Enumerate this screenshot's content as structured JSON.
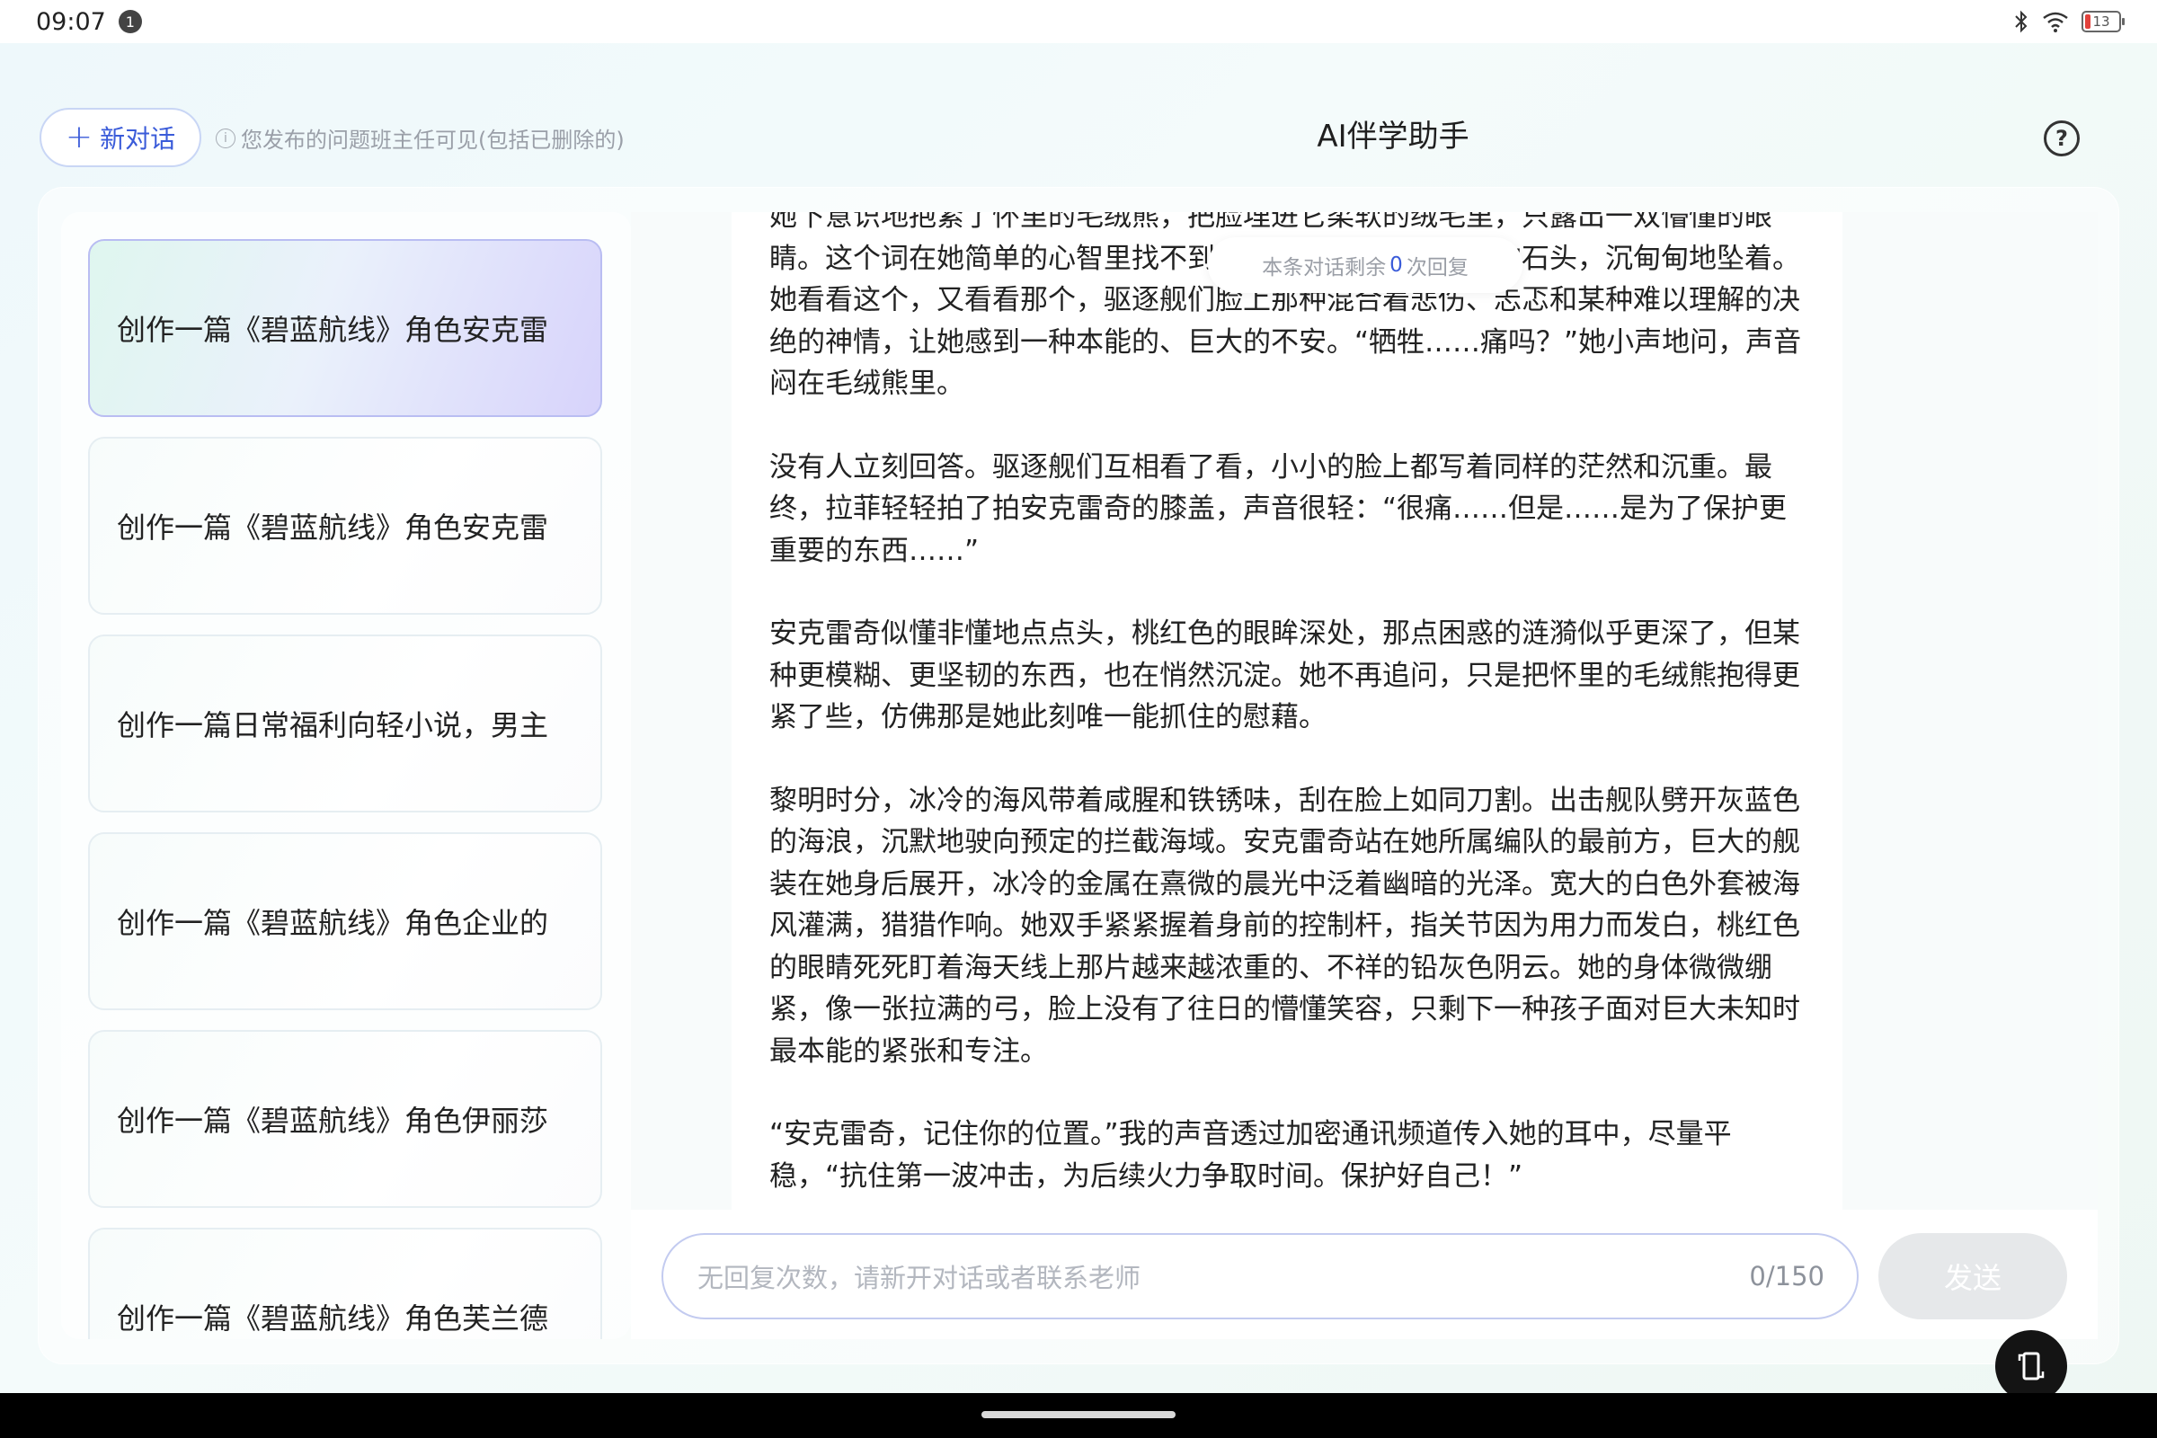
{
  "status_bar": {
    "time": "09:07",
    "notification_count": "1",
    "battery_level": "13"
  },
  "header": {
    "new_chat_label": "新对话",
    "notice": "您发布的问题班主任可见(包括已删除的)",
    "title": "AI伴学助手"
  },
  "sidebar": {
    "items": [
      {
        "label": "创作一篇《碧蓝航线》角色安克雷",
        "active": true
      },
      {
        "label": "创作一篇《碧蓝航线》角色安克雷",
        "active": false
      },
      {
        "label": "创作一篇日常福利向轻小说，男主",
        "active": false
      },
      {
        "label": "创作一篇《碧蓝航线》角色企业的",
        "active": false
      },
      {
        "label": "创作一篇《碧蓝航线》角色伊丽莎",
        "active": false
      },
      {
        "label": "创作一篇《碧蓝航线》角色芙兰德",
        "active": false
      }
    ]
  },
  "conversation": {
    "remaining_prefix": "本条对话剩余",
    "remaining_count": "0",
    "remaining_suffix": "次回复",
    "paragraphs": [
      "她下意识地抱紧了怀里的毛绒熊，把脸埋进它柔软的绒毛里，只露出一双懵懂的眼睛。这个词在她简单的心智里找不到对应的……像一块沉重的石头，沉甸甸地坠着。她看看这个，又看看那个，驱逐舰们脸上那种混合着悲伤、忐忑和某种难以理解的决绝的神情，让她感到一种本能的、巨大的不安。“牺牲……痛吗？”她小声地问，声音闷在毛绒熊里。",
      "没有人立刻回答。驱逐舰们互相看了看，小小的脸上都写着同样的茫然和沉重。最终，拉菲轻轻拍了拍安克雷奇的膝盖，声音很轻：“很痛……但是……是为了保护更重要的东西……”",
      "安克雷奇似懂非懂地点点头，桃红色的眼眸深处，那点困惑的涟漪似乎更深了，但某种更模糊、更坚韧的东西，也在悄然沉淀。她不再追问，只是把怀里的毛绒熊抱得更紧了些，仿佛那是她此刻唯一能抓住的慰藉。",
      "黎明时分，冰冷的海风带着咸腥和铁锈味，刮在脸上如同刀割。出击舰队劈开灰蓝色的海浪，沉默地驶向预定的拦截海域。安克雷奇站在她所属编队的最前方，巨大的舰装在她身后展开，冰冷的金属在熹微的晨光中泛着幽暗的光泽。宽大的白色外套被海风灌满，猎猎作响。她双手紧紧握着身前的控制杆，指关节因为用力而发白，桃红色的眼睛死死盯着海天线上那片越来越浓重的、不祥的铅灰色阴云。她的身体微微绷紧，像一张拉满的弓，脸上没有了往日的懵懂笑容，只剩下一种孩子面对巨大未知时最本能的紧张和专注。",
      "“安克雷奇，记住你的位置。”我的声音透过加密通讯频道传入她的耳中，尽量平稳，“抗住第一波冲击，为后续火力争取时间。保护好自己！”"
    ]
  },
  "composer": {
    "placeholder": "无回复次数，请新开对话或者联系老师",
    "counter": "0/150",
    "send_label": "发送"
  }
}
